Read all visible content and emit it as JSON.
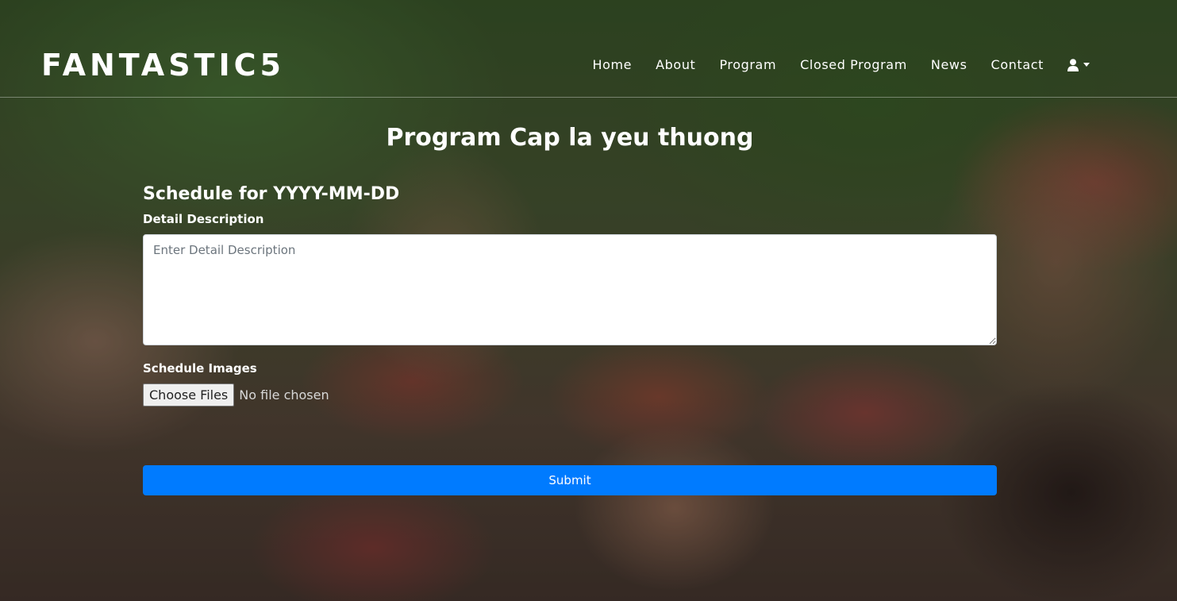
{
  "brand": {
    "name": "FANTASTIC5"
  },
  "nav": {
    "items": [
      {
        "label": "Home"
      },
      {
        "label": "About"
      },
      {
        "label": "Program"
      },
      {
        "label": "Closed Program"
      },
      {
        "label": "News"
      },
      {
        "label": "Contact"
      }
    ],
    "user_icon": "user-icon"
  },
  "page": {
    "title_prefix": "Program",
    "title_program": "Cap la yeu thuong"
  },
  "form": {
    "schedule_heading": "Schedule for YYYY-MM-DD",
    "description_label": "Detail Description",
    "description_placeholder": "Enter Detail Description",
    "description_value": "",
    "images_label": "Schedule Images",
    "choose_files_label": "Choose Files",
    "file_status": "No file chosen",
    "submit_label": "Submit"
  },
  "colors": {
    "primary_button": "#007bff",
    "text": "#ffffff"
  }
}
